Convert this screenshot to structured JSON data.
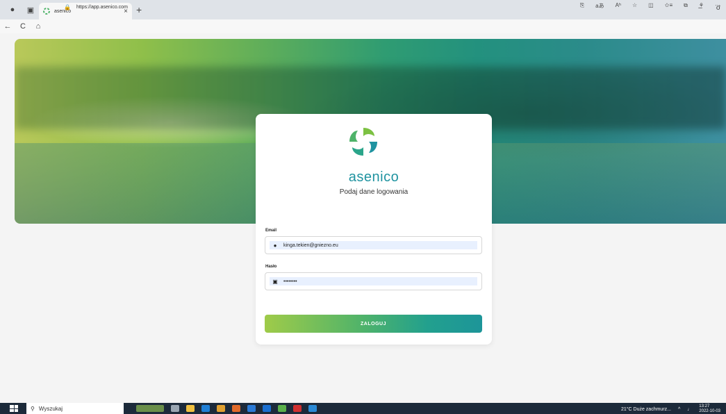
{
  "browser": {
    "tab_title": "asenico",
    "tab_close": "×",
    "new_tab": "+",
    "url": "https://app.asenico.com",
    "win_minimize": "–",
    "win_restore": "σ",
    "nav_back": "←",
    "nav_reload": "C",
    "nav_home": "⌂",
    "lock_icon": "🔒",
    "toolbar_icons": [
      "⎘",
      "aあ",
      "Aʰ",
      "☆",
      "◫",
      "✩≡",
      "⧉",
      "⚘",
      "···"
    ]
  },
  "login": {
    "brand": "asenico",
    "subtitle": "Podaj dane logowania",
    "email_label": "Email",
    "email_value": "kinga.tekien@gniezno.eu",
    "password_label": "Hasło",
    "password_value": "••••••••",
    "button_label": "ZALOGUJ",
    "colors": {
      "teal": "#1f93a0",
      "green": "#9fcb49",
      "autofill": "#e8f0fe"
    }
  },
  "taskbar": {
    "search_placeholder": "Wyszukaj",
    "weather": "21°C  Duże zachmurz...",
    "time": "13:27",
    "date": "2022-10-03"
  }
}
